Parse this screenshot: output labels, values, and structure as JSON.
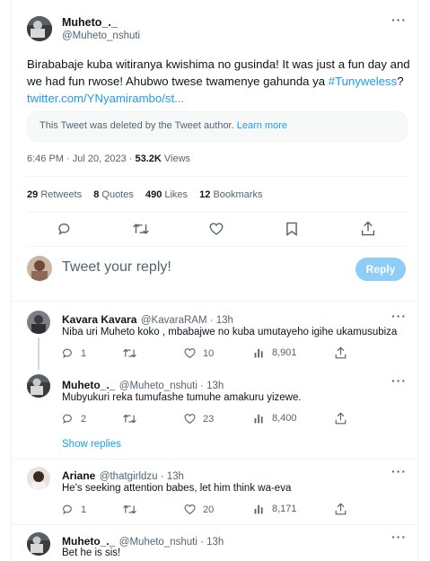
{
  "tweet": {
    "author_name": "Muheto_._",
    "author_handle": "@Muheto_nshuti",
    "text_line1": "Birababaje kuba witiranya kwishima no gusinda! It was just a fun day and",
    "text_line2a": "we had fun rwose! Ahubwo twese twamenye gahunda ya ",
    "hashtag": "#Tunyweless",
    "text_line2b": "?",
    "link": "twitter.com/YNyamirambo/st...",
    "deleted_notice": "This Tweet was deleted by the Tweet author.",
    "learn_more": "Learn more",
    "timestamp": "6:46 PM · Jul 20, 2023 · ",
    "views_count": "53.2K",
    "views_label": " Views",
    "stats": {
      "retweets_count": "29",
      "retweets_label": "Retweets",
      "quotes_count": "8",
      "quotes_label": "Quotes",
      "likes_count": "490",
      "likes_label": "Likes",
      "bookmarks_count": "12",
      "bookmarks_label": "Bookmarks"
    }
  },
  "reply_box": {
    "placeholder": "Tweet your reply!",
    "button": "Reply"
  },
  "replies": [
    {
      "name": "Kavara Kavara",
      "handle": "@KavaraRAM · 13h",
      "text": "Niba uri Muheto koko , mbabajwe no kuba umutayeho igihe ukamusubiza",
      "replies": "1",
      "likes": "10",
      "views": "8,901"
    },
    {
      "name": "Muheto_._",
      "handle": "@Muheto_nshuti · 13h",
      "text": "Mubyukuri reka tumufashe tumuhe amakuru yizewe.",
      "replies": "2",
      "likes": "23",
      "views": "8,400"
    },
    {
      "name": "Ariane",
      "handle": "@thatgirldzu · 13h",
      "text": "He's seeking attention babes, let him think wa-eva",
      "replies": "1",
      "likes": "20",
      "views": "8,171"
    },
    {
      "name": "Muheto_._",
      "handle": "@Muheto_nshuti · 13h",
      "text": "Bet he is sis!"
    }
  ],
  "show_replies": "Show replies",
  "colors": {
    "accent": "#1d9bf0",
    "reply_button_disabled": "#8ecdf8",
    "muted": "#536471"
  }
}
